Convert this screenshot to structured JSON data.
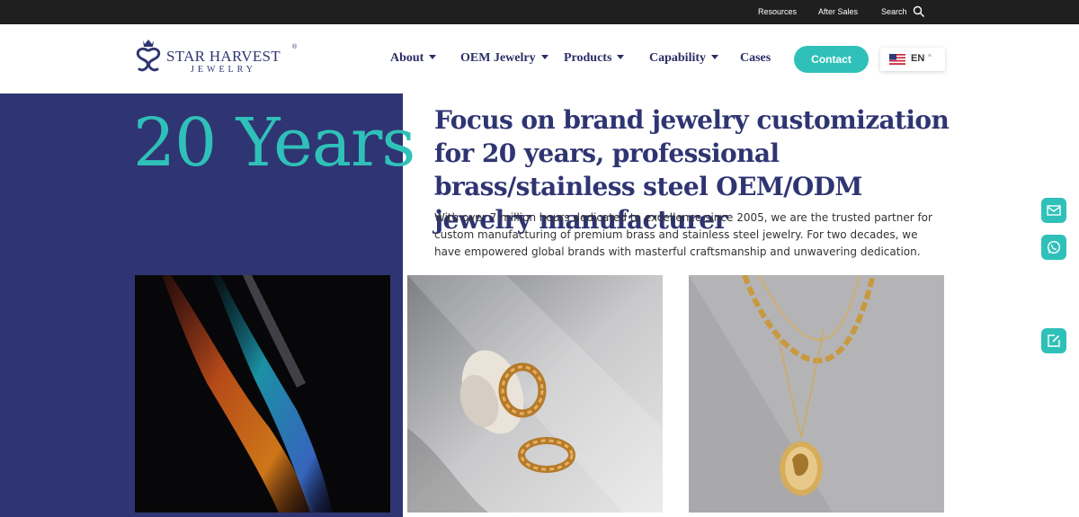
{
  "topbar": {
    "links": [
      "Resources",
      "After Sales",
      "Search"
    ],
    "search_icon": "search-icon"
  },
  "brand": {
    "name": "STAR HARVEST",
    "sub": "JEWELRY",
    "reg": "®",
    "primary_color": "#2f3572",
    "accent_color": "#2fc1b9"
  },
  "nav": {
    "items": [
      {
        "label": "About",
        "dropdown": true
      },
      {
        "label": "OEM Jewelry",
        "dropdown": true
      },
      {
        "label": "Products",
        "dropdown": true
      },
      {
        "label": "Capability",
        "dropdown": true
      },
      {
        "label": "Cases",
        "dropdown": false
      }
    ],
    "contact_label": "Contact",
    "language": {
      "code": "EN",
      "flag": "us-flag-icon"
    }
  },
  "hero": {
    "big_text": "20 Years",
    "headline": "Focus on brand jewelry customization for 20 years, professional brass/stainless steel OEM/ODM jewelry manufacturer",
    "description": "With over 7 million hours dedicated to excellence since 2005, we are the trusted partner for custom manufacturing of premium brass and stainless steel jewelry. For two decades, we have empowered global brands with masterful craftsmanship and unwavering dedication."
  },
  "floating": {
    "icons": [
      "email-icon",
      "whatsapp-icon",
      "edit-icon"
    ]
  }
}
